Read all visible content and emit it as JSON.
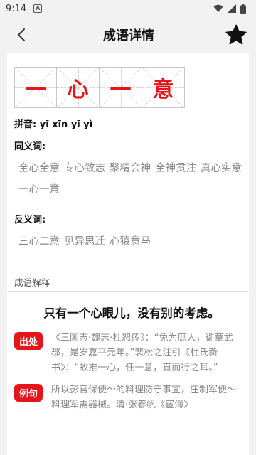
{
  "status_bar": {
    "time": "9:14",
    "badge": "A"
  },
  "app_bar": {
    "title": "成语详情"
  },
  "idiom": {
    "chars": [
      "一",
      "心",
      "一",
      "意"
    ]
  },
  "pinyin": {
    "label": "拼音:",
    "value": "yī xīn yī yì"
  },
  "synonyms": {
    "label": "同义词:",
    "items": [
      "全心全意",
      "专心致志",
      "聚精会神",
      "全神贯注",
      "真心实意",
      "一心一意"
    ]
  },
  "antonyms": {
    "label": "反义词:",
    "items": [
      "三心二意",
      "见异思迁",
      "心猿意马"
    ]
  },
  "explanation": {
    "header": "成语解释",
    "meaning": "只有一个心眼儿，没有别的考虑。",
    "source_tag": "出处",
    "source_text": "《三国志·魏志·杜恕传》：“免为庶人，徙章武郡，是岁嘉平元年。”裴松之注引《杜氏新书》：“故推一心，任一意，直而行之耳。”",
    "example_tag": "例句",
    "example_text": "所以彭官保便～的料理防守事宜，庄制军便～料理军需器械。清·张春帆《宦海》"
  }
}
